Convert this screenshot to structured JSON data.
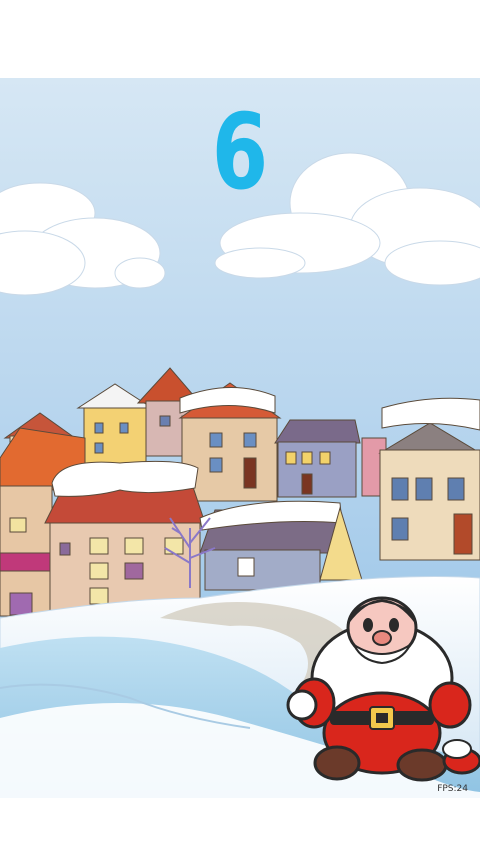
{
  "game": {
    "score": "6",
    "fps_label": "FPS:24"
  },
  "colors": {
    "score": "#1fb7ea",
    "sky_top": "#cfe3f3",
    "sky_bottom": "#8fbfe6",
    "snow": "#ffffff",
    "santa_red": "#d9261c"
  },
  "icons": {
    "character": "santa-icon"
  }
}
